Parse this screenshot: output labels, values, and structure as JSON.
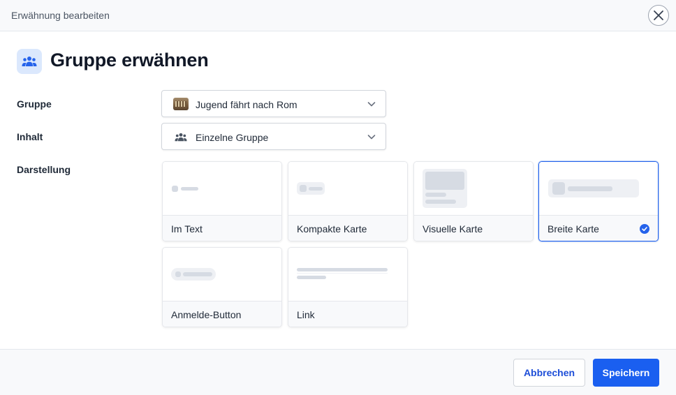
{
  "dialog": {
    "title": "Erwähnung bearbeiten",
    "heading": "Gruppe erwähnen",
    "heading_icon": "group-icon",
    "close_icon": "close-icon"
  },
  "form": {
    "group": {
      "label": "Gruppe",
      "value": "Jugend fährt nach Rom",
      "icon": "colosseum-thumbnail"
    },
    "content": {
      "label": "Inhalt",
      "value": "Einzelne Gruppe",
      "icon": "group-icon"
    },
    "display": {
      "label": "Darstellung",
      "options": [
        {
          "label": "Im Text",
          "selected": false
        },
        {
          "label": "Kompakte Karte",
          "selected": false
        },
        {
          "label": "Visuelle Karte",
          "selected": false
        },
        {
          "label": "Breite Karte",
          "selected": true
        },
        {
          "label": "Anmelde-Button",
          "selected": false
        },
        {
          "label": "Link",
          "selected": false
        }
      ]
    }
  },
  "actions": {
    "cancel": "Abbrechen",
    "save": "Speichern"
  },
  "colors": {
    "accent": "#1a5ff0",
    "selected_border": "#2563eb"
  }
}
